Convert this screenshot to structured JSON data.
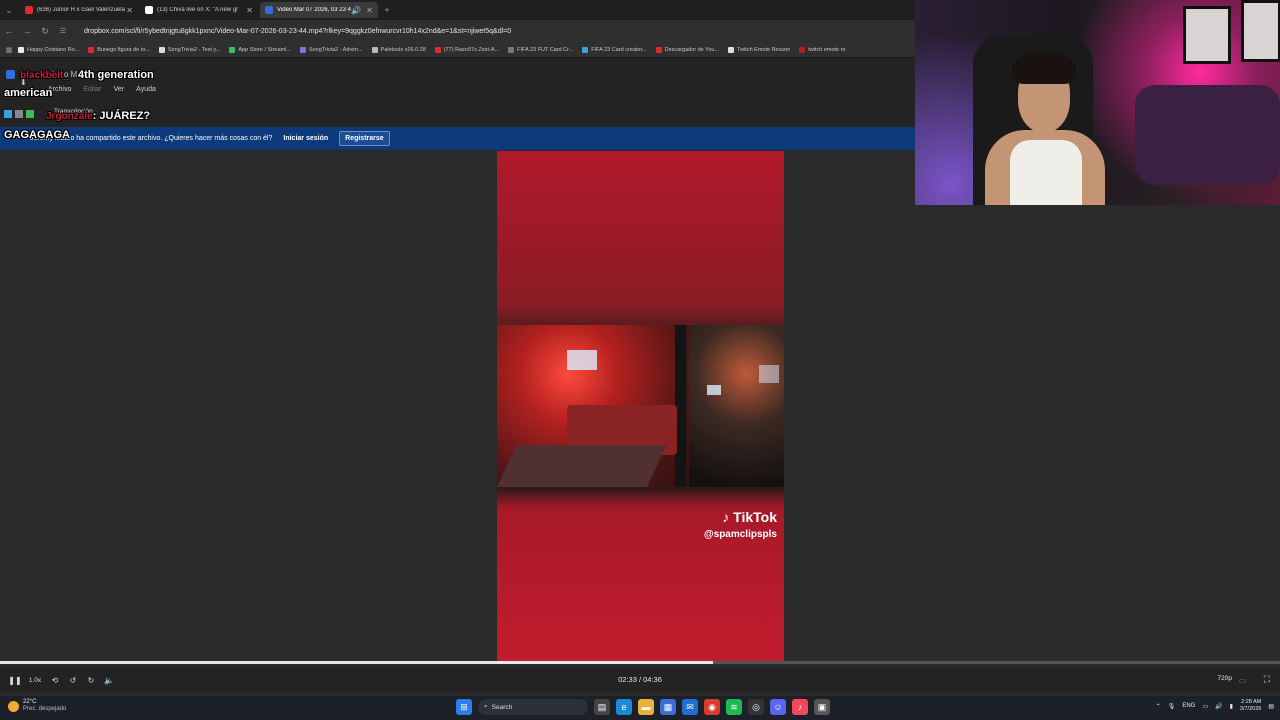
{
  "browser": {
    "tabs": [
      {
        "title": "(636) Junior H x Gael Valenzuela",
        "color": "#e02a2a"
      },
      {
        "title": "(13) Chiva live on X: \"A new gr",
        "color": "#ffffff"
      },
      {
        "title": "Video Mar 07 2026, 03 23 4",
        "color": "#2b6fe0",
        "active": true
      }
    ],
    "new_tab": "+",
    "url": "dropbox.com/scl/fi/r5ybedtnjgtu8gkk1pxnc/Video-Mar-07-2026-03-23-44.mp4?rlkey=9qggkz0efnwurcvr10h14x2nd&e=1&st=njiwet5q&dl=0",
    "bookmarks": [
      {
        "label": "Happy Cristiano Ro...",
        "color": "#e8e8e8"
      },
      {
        "label": "Buriego figura de to...",
        "color": "#d82a2a"
      },
      {
        "label": "SongTrivia2 - Test y...",
        "color": "#dcdcdc"
      },
      {
        "label": "App Store / Streaml...",
        "color": "#3cbf5a"
      },
      {
        "label": "SongTrivia2 - Advim...",
        "color": "#8a6fe0"
      },
      {
        "label": "Paletools v26.0.28",
        "color": "#bbbbbb"
      },
      {
        "label": "(77) Razo97s Zest-A...",
        "color": "#e02a2a"
      },
      {
        "label": "FIFA 23 FUT Card Cr...",
        "color": "#777777"
      },
      {
        "label": "FIFA 23 Card creator...",
        "color": "#3aa0e0"
      },
      {
        "label": "Descargador de You...",
        "color": "#e02a2a"
      },
      {
        "label": "Twitch Emote Resizer",
        "color": "#dddddd"
      },
      {
        "label": "twitch emote re",
        "color": "#b02020"
      }
    ]
  },
  "dropbox": {
    "title_small": "Video Mar",
    "menu": [
      "Archivo",
      "Editar",
      "Ver",
      "Ayuda"
    ],
    "transcription": "Transcripción",
    "banner_text": "Jeremy Mateo ha compartido este archivo. ¿Quieres hacer más cosas con él?",
    "login": "Iniciar sesión",
    "register": "Registrarse"
  },
  "chat": {
    "line1_user": "blackbelt_",
    "line1_text": "4th generation",
    "line2_text": "american",
    "line3_user": "Jrgonzale",
    "line3_text": ": JUÁREZ?",
    "line4_text": "GAGAGAGA"
  },
  "video": {
    "watermark": "TikTok",
    "handle": "@spamclipspls"
  },
  "player": {
    "speed": "1.0x",
    "time": "02:33 / 04:36",
    "quality": "720p",
    "progress": 0.557
  },
  "taskbar": {
    "temp": "22°C",
    "weather": "Prec. despejado",
    "search": "Search",
    "lang": "ENG",
    "time": "2:28 AM",
    "date": "3/7/2026"
  }
}
